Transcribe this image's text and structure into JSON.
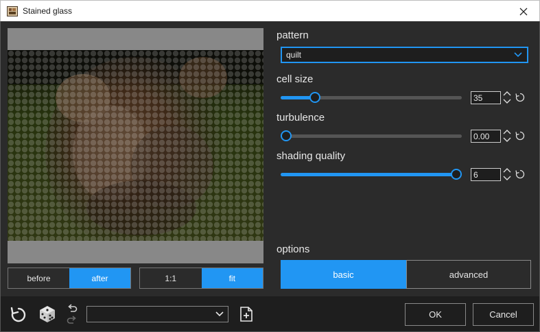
{
  "window": {
    "title": "Stained glass"
  },
  "preview": {
    "before_label": "before",
    "after_label": "after",
    "zoom_1to1_label": "1:1",
    "zoom_fit_label": "fit",
    "active_view": "after",
    "active_zoom": "fit"
  },
  "params": {
    "pattern_label": "pattern",
    "pattern_value": "quilt",
    "cell_size_label": "cell size",
    "cell_size_value": "35",
    "cell_size_fraction": 0.17,
    "turbulence_label": "turbulence",
    "turbulence_value": "0.00",
    "turbulence_fraction": 0.0,
    "shading_label": "shading quality",
    "shading_value": "6",
    "shading_fraction": 1.0
  },
  "options": {
    "label": "options",
    "basic_label": "basic",
    "advanced_label": "advanced",
    "active": "basic"
  },
  "footer": {
    "ok_label": "OK",
    "cancel_label": "Cancel",
    "preset_value": ""
  },
  "colors": {
    "accent": "#2196f3",
    "panel_bg": "#2b2b2b",
    "footer_bg": "#1e1e1e"
  }
}
